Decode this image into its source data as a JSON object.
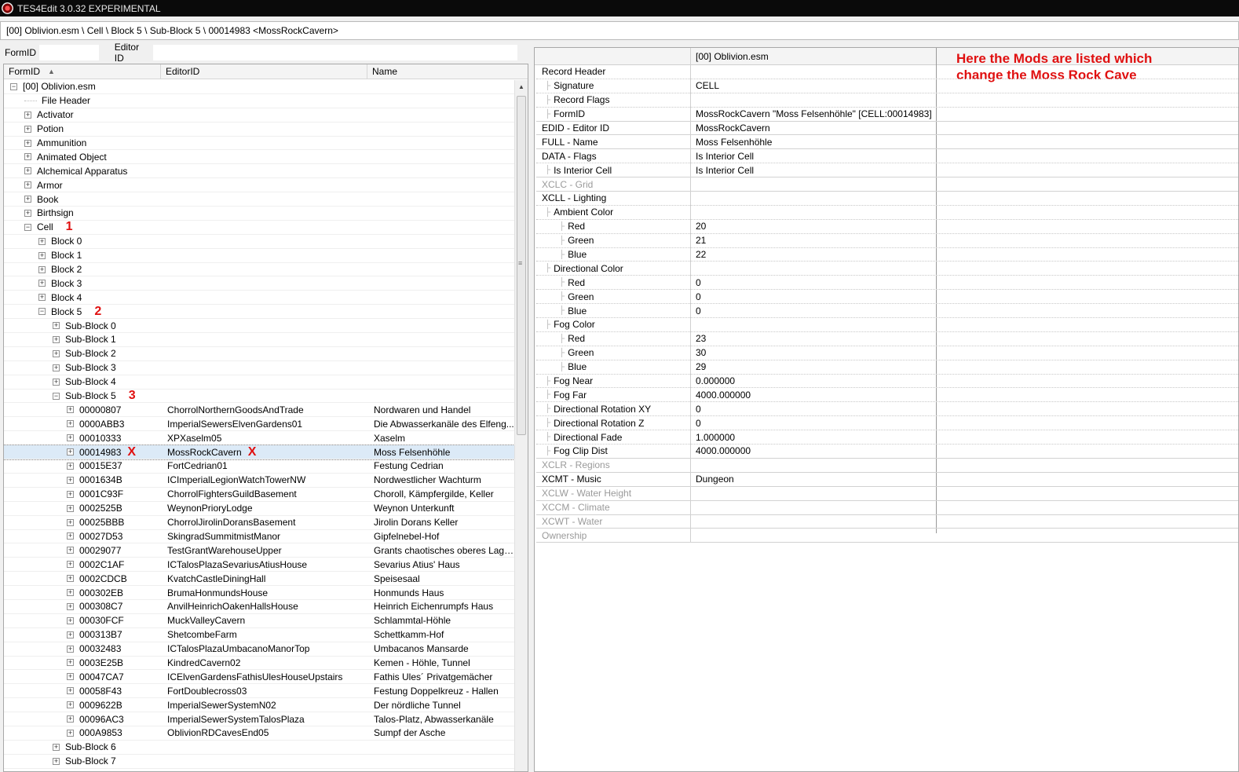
{
  "window": {
    "title": "TES4Edit 3.0.32 EXPERIMENTAL"
  },
  "path": "[00] Oblivion.esm \\ Cell \\ Block 5 \\ Sub-Block 5 \\ 00014983 <MossRockCavern>",
  "filter": {
    "formid_label": "FormID",
    "editorid_label": "Editor ID"
  },
  "tree": {
    "columns": [
      "FormID",
      "EditorID",
      "Name"
    ],
    "rows": [
      {
        "indent": 0,
        "exp": "-",
        "formid": "[00] Oblivion.esm",
        "editorid": "",
        "name": ""
      },
      {
        "indent": 1,
        "exp": "",
        "formid": "File Header",
        "editorid": "",
        "name": ""
      },
      {
        "indent": 1,
        "exp": "+",
        "formid": "Activator",
        "editorid": "",
        "name": ""
      },
      {
        "indent": 1,
        "exp": "+",
        "formid": "Potion",
        "editorid": "",
        "name": ""
      },
      {
        "indent": 1,
        "exp": "+",
        "formid": "Ammunition",
        "editorid": "",
        "name": ""
      },
      {
        "indent": 1,
        "exp": "+",
        "formid": "Animated Object",
        "editorid": "",
        "name": ""
      },
      {
        "indent": 1,
        "exp": "+",
        "formid": "Alchemical Apparatus",
        "editorid": "",
        "name": ""
      },
      {
        "indent": 1,
        "exp": "+",
        "formid": "Armor",
        "editorid": "",
        "name": ""
      },
      {
        "indent": 1,
        "exp": "+",
        "formid": "Book",
        "editorid": "",
        "name": ""
      },
      {
        "indent": 1,
        "exp": "+",
        "formid": "Birthsign",
        "editorid": "",
        "name": ""
      },
      {
        "indent": 1,
        "exp": "-",
        "formid": "Cell",
        "editorid": "",
        "name": "",
        "ann": "1"
      },
      {
        "indent": 2,
        "exp": "+",
        "formid": "Block 0",
        "editorid": "",
        "name": ""
      },
      {
        "indent": 2,
        "exp": "+",
        "formid": "Block 1",
        "editorid": "",
        "name": ""
      },
      {
        "indent": 2,
        "exp": "+",
        "formid": "Block 2",
        "editorid": "",
        "name": ""
      },
      {
        "indent": 2,
        "exp": "+",
        "formid": "Block 3",
        "editorid": "",
        "name": ""
      },
      {
        "indent": 2,
        "exp": "+",
        "formid": "Block 4",
        "editorid": "",
        "name": ""
      },
      {
        "indent": 2,
        "exp": "-",
        "formid": "Block 5",
        "editorid": "",
        "name": "",
        "ann": "2"
      },
      {
        "indent": 3,
        "exp": "+",
        "formid": "Sub-Block 0",
        "editorid": "",
        "name": ""
      },
      {
        "indent": 3,
        "exp": "+",
        "formid": "Sub-Block 1",
        "editorid": "",
        "name": ""
      },
      {
        "indent": 3,
        "exp": "+",
        "formid": "Sub-Block 2",
        "editorid": "",
        "name": ""
      },
      {
        "indent": 3,
        "exp": "+",
        "formid": "Sub-Block 3",
        "editorid": "",
        "name": ""
      },
      {
        "indent": 3,
        "exp": "+",
        "formid": "Sub-Block 4",
        "editorid": "",
        "name": ""
      },
      {
        "indent": 3,
        "exp": "-",
        "formid": "Sub-Block 5",
        "editorid": "",
        "name": "",
        "ann": "3"
      },
      {
        "indent": 4,
        "exp": "+",
        "formid": "00000807",
        "editorid": "ChorrolNorthernGoodsAndTrade",
        "name": "Nordwaren und Handel"
      },
      {
        "indent": 4,
        "exp": "+",
        "formid": "0000ABB3",
        "editorid": "ImperialSewersElvenGardens01",
        "name": "Die Abwasserkanäle des Elfeng..."
      },
      {
        "indent": 4,
        "exp": "+",
        "formid": "00010333",
        "editorid": "XPXaselm05",
        "name": "Xaselm"
      },
      {
        "indent": 4,
        "exp": "+",
        "formid": "00014983",
        "editorid": "MossRockCavern",
        "name": "Moss Felsenhöhle",
        "selected": true,
        "annx": "X"
      },
      {
        "indent": 4,
        "exp": "+",
        "formid": "00015E37",
        "editorid": "FortCedrian01",
        "name": "Festung Cedrian"
      },
      {
        "indent": 4,
        "exp": "+",
        "formid": "0001634B",
        "editorid": "ICImperialLegionWatchTowerNW",
        "name": "Nordwestlicher Wachturm"
      },
      {
        "indent": 4,
        "exp": "+",
        "formid": "0001C93F",
        "editorid": "ChorrolFightersGuildBasement",
        "name": "Choroll, Kämpfergilde, Keller"
      },
      {
        "indent": 4,
        "exp": "+",
        "formid": "0002525B",
        "editorid": "WeynonPrioryLodge",
        "name": "Weynon Unterkunft"
      },
      {
        "indent": 4,
        "exp": "+",
        "formid": "00025BBB",
        "editorid": "ChorrolJirolinDoransBasement",
        "name": "Jirolin Dorans Keller"
      },
      {
        "indent": 4,
        "exp": "+",
        "formid": "00027D53",
        "editorid": "SkingradSummitmistManor",
        "name": "Gipfelnebel-Hof"
      },
      {
        "indent": 4,
        "exp": "+",
        "formid": "00029077",
        "editorid": "TestGrantWarehouseUpper",
        "name": "Grants chaotisches oberes Lage..."
      },
      {
        "indent": 4,
        "exp": "+",
        "formid": "0002C1AF",
        "editorid": "ICTalosPlazaSevariusAtiusHouse",
        "name": "Sevarius Atius' Haus"
      },
      {
        "indent": 4,
        "exp": "+",
        "formid": "0002CDCB",
        "editorid": "KvatchCastleDiningHall",
        "name": "Speisesaal"
      },
      {
        "indent": 4,
        "exp": "+",
        "formid": "000302EB",
        "editorid": "BrumaHonmundsHouse",
        "name": "Honmunds Haus"
      },
      {
        "indent": 4,
        "exp": "+",
        "formid": "000308C7",
        "editorid": "AnvilHeinrichOakenHallsHouse",
        "name": "Heinrich Eichenrumpfs Haus"
      },
      {
        "indent": 4,
        "exp": "+",
        "formid": "00030FCF",
        "editorid": "MuckValleyCavern",
        "name": "Schlammtal-Höhle"
      },
      {
        "indent": 4,
        "exp": "+",
        "formid": "000313B7",
        "editorid": "ShetcombeFarm",
        "name": "Schettkamm-Hof"
      },
      {
        "indent": 4,
        "exp": "+",
        "formid": "00032483",
        "editorid": "ICTalosPlazaUmbacanoManorTop",
        "name": "Umbacanos Mansarde"
      },
      {
        "indent": 4,
        "exp": "+",
        "formid": "0003E25B",
        "editorid": "KindredCavern02",
        "name": "Kemen - Höhle, Tunnel"
      },
      {
        "indent": 4,
        "exp": "+",
        "formid": "00047CA7",
        "editorid": "ICElvenGardensFathisUlesHouseUpstairs",
        "name": "Fathis Ules´ Privatgemächer"
      },
      {
        "indent": 4,
        "exp": "+",
        "formid": "00058F43",
        "editorid": "FortDoublecross03",
        "name": "Festung Doppelkreuz - Hallen"
      },
      {
        "indent": 4,
        "exp": "+",
        "formid": "0009622B",
        "editorid": "ImperialSewerSystemN02",
        "name": "Der nördliche Tunnel"
      },
      {
        "indent": 4,
        "exp": "+",
        "formid": "00096AC3",
        "editorid": "ImperialSewerSystemTalosPlaza",
        "name": "Talos-Platz, Abwasserkanäle"
      },
      {
        "indent": 4,
        "exp": "+",
        "formid": "000A9853",
        "editorid": "OblivionRDCavesEnd05",
        "name": "Sumpf der Asche"
      },
      {
        "indent": 3,
        "exp": "+",
        "formid": "Sub-Block 6",
        "editorid": "",
        "name": ""
      },
      {
        "indent": 3,
        "exp": "+",
        "formid": "Sub-Block 7",
        "editorid": "",
        "name": ""
      }
    ]
  },
  "record": {
    "column_header": "[00] Oblivion.esm",
    "annotation_line1": "Here the Mods are listed which",
    "annotation_line2": "change the Moss Rock Cave",
    "rows": [
      {
        "indent": 0,
        "label": "Record Header",
        "value": "",
        "dim": false,
        "section": false
      },
      {
        "indent": 1,
        "label": "Signature",
        "value": "CELL",
        "dim": false,
        "section": false
      },
      {
        "indent": 1,
        "label": "Record Flags",
        "value": "",
        "dim": false,
        "section": false
      },
      {
        "indent": 1,
        "label": "FormID",
        "value": "MossRockCavern \"Moss Felsenhöhle\" [CELL:00014983]",
        "dim": false,
        "section": true
      },
      {
        "indent": 0,
        "label": "EDID - Editor ID",
        "value": "MossRockCavern",
        "dim": false,
        "section": true
      },
      {
        "indent": 0,
        "label": "FULL - Name",
        "value": "Moss Felsenhöhle",
        "dim": false,
        "section": true
      },
      {
        "indent": 0,
        "label": "DATA - Flags",
        "value": "Is Interior Cell",
        "dim": false,
        "section": false
      },
      {
        "indent": 1,
        "label": "Is Interior Cell",
        "value": "Is Interior Cell",
        "dim": false,
        "section": true
      },
      {
        "indent": 0,
        "label": "XCLC - Grid",
        "value": "",
        "dim": true,
        "section": true
      },
      {
        "indent": 0,
        "label": "XCLL - Lighting",
        "value": "",
        "dim": false,
        "section": false
      },
      {
        "indent": 1,
        "label": "Ambient Color",
        "value": "",
        "dim": false,
        "section": false
      },
      {
        "indent": 2,
        "label": "Red",
        "value": "20",
        "dim": false,
        "section": false
      },
      {
        "indent": 2,
        "label": "Green",
        "value": "21",
        "dim": false,
        "section": false
      },
      {
        "indent": 2,
        "label": "Blue",
        "value": "22",
        "dim": false,
        "section": false
      },
      {
        "indent": 1,
        "label": "Directional Color",
        "value": "",
        "dim": false,
        "section": false
      },
      {
        "indent": 2,
        "label": "Red",
        "value": "0",
        "dim": false,
        "section": false
      },
      {
        "indent": 2,
        "label": "Green",
        "value": "0",
        "dim": false,
        "section": false
      },
      {
        "indent": 2,
        "label": "Blue",
        "value": "0",
        "dim": false,
        "section": false
      },
      {
        "indent": 1,
        "label": "Fog Color",
        "value": "",
        "dim": false,
        "section": false
      },
      {
        "indent": 2,
        "label": "Red",
        "value": "23",
        "dim": false,
        "section": false
      },
      {
        "indent": 2,
        "label": "Green",
        "value": "30",
        "dim": false,
        "section": false
      },
      {
        "indent": 2,
        "label": "Blue",
        "value": "29",
        "dim": false,
        "section": false
      },
      {
        "indent": 1,
        "label": "Fog Near",
        "value": "0.000000",
        "dim": false,
        "section": false
      },
      {
        "indent": 1,
        "label": "Fog Far",
        "value": "4000.000000",
        "dim": false,
        "section": false
      },
      {
        "indent": 1,
        "label": "Directional Rotation XY",
        "value": "0",
        "dim": false,
        "section": false
      },
      {
        "indent": 1,
        "label": "Directional Rotation Z",
        "value": "0",
        "dim": false,
        "section": false
      },
      {
        "indent": 1,
        "label": "Directional Fade",
        "value": "1.000000",
        "dim": false,
        "section": false
      },
      {
        "indent": 1,
        "label": "Fog Clip Dist",
        "value": "4000.000000",
        "dim": false,
        "section": true
      },
      {
        "indent": 0,
        "label": "XCLR - Regions",
        "value": "",
        "dim": true,
        "section": true
      },
      {
        "indent": 0,
        "label": "XCMT - Music",
        "value": "Dungeon",
        "dim": false,
        "section": true
      },
      {
        "indent": 0,
        "label": "XCLW - Water Height",
        "value": "",
        "dim": true,
        "section": true
      },
      {
        "indent": 0,
        "label": "XCCM - Climate",
        "value": "",
        "dim": true,
        "section": true
      },
      {
        "indent": 0,
        "label": "XCWT - Water",
        "value": "",
        "dim": true,
        "section": true
      },
      {
        "indent": 0,
        "label": "Ownership",
        "value": "",
        "dim": true,
        "section": true
      }
    ]
  }
}
